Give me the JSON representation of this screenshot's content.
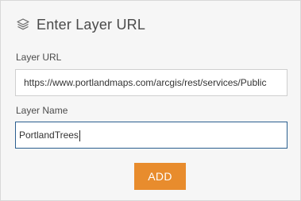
{
  "panel": {
    "title": "Enter Layer URL",
    "title_icon": "layers-icon"
  },
  "layer_url": {
    "label": "Layer URL",
    "value": "https://www.portlandmaps.com/arcgis/rest/services/Public"
  },
  "layer_name": {
    "label": "Layer Name",
    "value": "PortlandTrees"
  },
  "add_button": {
    "label": "ADD",
    "color": "#e88c2d"
  },
  "colors": {
    "panel_background": "#f6f6f6",
    "focus_border": "#2b5f8f"
  }
}
